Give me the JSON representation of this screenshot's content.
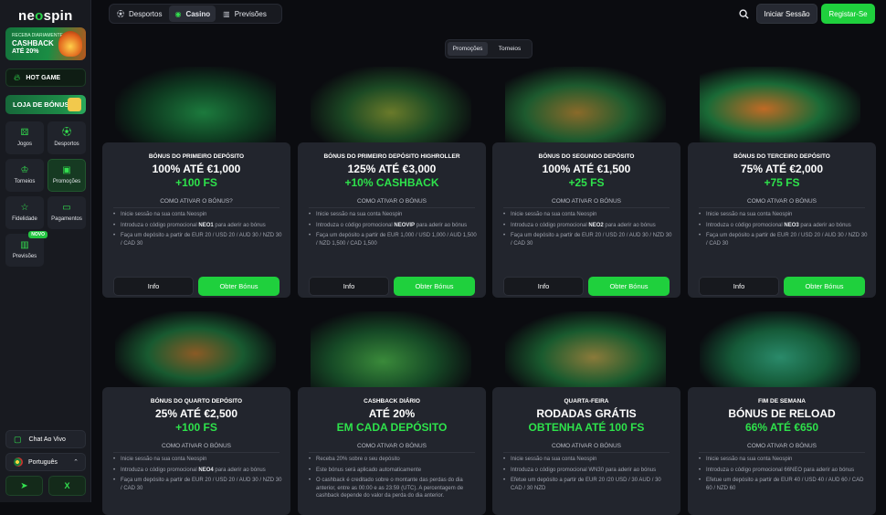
{
  "brand": {
    "logo_pre": "ne",
    "logo_o": "o",
    "logo_post": "spin"
  },
  "sidebar": {
    "cashback_promo": {
      "line1": "RECEBA DIARIAMENTE",
      "line2": "CASHBACK",
      "line3": "ATÉ 20%"
    },
    "hot_game": "HOT GAME",
    "bonus_shop": "LOJA DE BÓNUS",
    "nav": [
      {
        "label": "Jogos",
        "icon": "dice-icon"
      },
      {
        "label": "Desportos",
        "icon": "football-icon"
      },
      {
        "label": "Torneios",
        "icon": "trophy-icon"
      },
      {
        "label": "Promoções",
        "icon": "gift-icon"
      },
      {
        "label": "Fidelidade",
        "icon": "star-icon"
      },
      {
        "label": "Pagamentos",
        "icon": "wallet-icon"
      },
      {
        "label": "Previsões",
        "icon": "chart-icon",
        "badge": "NOVO"
      }
    ],
    "chat": "Chat Ao Vivo",
    "language": "Português"
  },
  "topbar": {
    "tabs": [
      {
        "label": "Desportos",
        "icon": "football-icon"
      },
      {
        "label": "Casino",
        "icon": "casino-chip-icon",
        "active": true
      },
      {
        "label": "Previsões",
        "icon": "chart-icon"
      }
    ],
    "login": "Iniciar Sessão",
    "register": "Registar-Se"
  },
  "subtabs": [
    "Promoções",
    "Torneios"
  ],
  "colors": {
    "accent": "#1fd03d",
    "bg": "#0b0c10",
    "card": "#22252d"
  },
  "cards": [
    {
      "small": "BÓNUS DO PRIMEIRO DEPÓSITO",
      "big": "100% ATÉ €1,000",
      "green": "+100 FS",
      "how": "COMO ATIVAR O BÓNUS?",
      "steps": [
        [
          "Inicie sessão na sua conta Neospin"
        ],
        [
          "Introduza o código promocional ",
          "NEO1",
          " para aderir ao bónus"
        ],
        [
          "Faça um depósito a partir de EUR 20 / USD 20 / AUD 30 / NZD 30 / CAD 30"
        ]
      ],
      "info": "Info",
      "get": "Obter Bónus"
    },
    {
      "small": "BÓNUS DO PRIMEIRO DEPÓSITO HIGHROLLER",
      "big": "125% ATÉ €3,000",
      "green": "+10% CASHBACK",
      "how": "COMO ATIVAR O BÓNUS",
      "steps": [
        [
          "Inicie sessão na sua conta Neospin"
        ],
        [
          "Introduza o código promocional ",
          "NEOVIP",
          " para aderir ao bónus"
        ],
        [
          "Faça um depósito a partir de EUR 1,000 / USD 1,000 / AUD 1,500 / NZD 1,500 / CAD 1,500"
        ]
      ],
      "info": "Info",
      "get": "Obter Bónus"
    },
    {
      "small": "BÓNUS DO SEGUNDO DEPÓSITO",
      "big": "100% ATÉ €1,500",
      "green": "+25 FS",
      "how": "COMO ATIVAR O BÓNUS",
      "steps": [
        [
          "Inicie sessão na sua conta Neospin"
        ],
        [
          "Introduza o código promocional ",
          "NEO2",
          " para aderir ao bónus"
        ],
        [
          "Faça um depósito a partir de EUR 20 / USD 20 / AUD 30 / NZD 30 / CAD 30"
        ]
      ],
      "info": "Info",
      "get": "Obter Bónus"
    },
    {
      "small": "BÓNUS DO TERCEIRO DEPÓSITO",
      "big": "75% ATÉ €2,000",
      "green": "+75 FS",
      "how": "COMO ATIVAR O BÓNUS",
      "steps": [
        [
          "Inicie sessão na sua conta Neospin"
        ],
        [
          "Introduza o código promocional ",
          "NEO3",
          " para aderir ao bónus"
        ],
        [
          "Faça um depósito a partir de EUR 20 / USD 20 / AUD 30 / NZD 30 / CAD 30"
        ]
      ],
      "info": "Info",
      "get": "Obter Bónus"
    },
    {
      "small": "BÓNUS DO QUARTO DEPÓSITO",
      "big": "25% ATÉ €2,500",
      "green": "+100 FS",
      "how": "COMO ATIVAR O BÓNUS",
      "steps": [
        [
          "Inicie sessão na sua conta Neospin"
        ],
        [
          "Introduza o código promocional ",
          "NEO4",
          " para aderir ao bónus"
        ],
        [
          "Faça um depósito a partir de EUR 20 / USD 20 / AUD 30 / NZD 30 / CAD 30"
        ]
      ]
    },
    {
      "small": "CASHBACK DIÁRIO",
      "big": "ATÉ 20%",
      "green": "EM CADA DEPÓSITO",
      "how": "COMO ATIVAR O BÓNUS",
      "steps": [
        [
          "Receba 20% sobre o seu depósito"
        ],
        [
          "Este bónus será aplicado automaticamente"
        ],
        [
          "O cashback é creditado sobre o montante das perdas do dia anterior, entre as 00:00 e as 23:59 (UTC). A percentagem de cashback depende do valor da perda do dia anterior."
        ]
      ]
    },
    {
      "small": "QUARTA-FEIRA",
      "big": "RODADAS GRÁTIS",
      "green": "OBTENHA ATÉ 100 FS",
      "how": "COMO ATIVAR O BÓNUS",
      "steps": [
        [
          "Inicie sessão na sua conta Neospin"
        ],
        [
          "Introduza o código promocional WN30 para aderir ao bónus"
        ],
        [
          "Efetue um depósito a partir de EUR 20 /20 USD / 30 AUD / 30 CAD / 30 NZD"
        ]
      ]
    },
    {
      "small": "FIM DE SEMANA",
      "big": "BÓNUS DE RELOAD",
      "green": "66% ATÉ €650",
      "how": "COMO ATIVAR O BÓNUS",
      "steps": [
        [
          "Inicie sessão na sua conta Neospin"
        ],
        [
          "Introduza o código promocional 66NEO para aderir ao bónus"
        ],
        [
          "Efetue um depósito a partir de EUR 40 / USD 40 / AUD 60 / CAD 60 / NZD 60"
        ]
      ]
    }
  ]
}
